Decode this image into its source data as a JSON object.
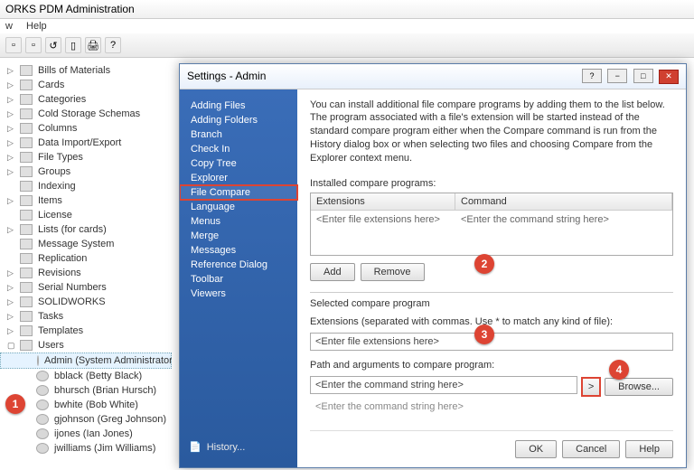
{
  "window": {
    "title": "ORKS PDM Administration"
  },
  "menu": {
    "item0": "w",
    "item1": "Help"
  },
  "tree": {
    "bom": "Bills of Materials",
    "cards": "Cards",
    "categories": "Categories",
    "cold": "Cold Storage Schemas",
    "columns": "Columns",
    "dataie": "Data Import/Export",
    "filetypes": "File Types",
    "groups": "Groups",
    "indexing": "Indexing",
    "items": "Items",
    "license": "License",
    "lists": "Lists (for cards)",
    "msg": "Message System",
    "replication": "Replication",
    "revisions": "Revisions",
    "serials": "Serial Numbers",
    "solidworks": "SOLIDWORKS",
    "tasks": "Tasks",
    "templates": "Templates",
    "users": "Users",
    "user0": "Admin (System Administrator)",
    "user1": "bblack (Betty Black)",
    "user2": "bhursch (Brian Hursch)",
    "user3": "bwhite (Bob White)",
    "user4": "gjohnson (Greg Johnson)",
    "user5": "ijones (Ian Jones)",
    "user6": "jwilliams (Jim Williams)"
  },
  "dlg": {
    "title": "Settings - Admin",
    "nav": {
      "adding_files": "Adding Files",
      "adding_folders": "Adding Folders",
      "branch": "Branch",
      "check_in": "Check In",
      "copy_tree": "Copy Tree",
      "explorer": "Explorer",
      "file_compare": "File Compare",
      "language": "Language",
      "menus": "Menus",
      "merge": "Merge",
      "messages": "Messages",
      "ref_dlg": "Reference Dialog",
      "toolbar": "Toolbar",
      "viewers": "Viewers",
      "history": "History..."
    },
    "content": {
      "intro": "You can install additional file compare programs by adding them to the list below. The program associated with a file's extension will be started instead of the standard compare program either when the Compare command is run from the History dialog box or when selecting two files and choosing Compare from the Explorer context menu.",
      "installed_lbl": "Installed compare programs:",
      "col_ext": "Extensions",
      "col_cmd": "Command",
      "row_ext_ph": "<Enter file extensions here>",
      "row_cmd_ph": "<Enter the command string here>",
      "add": "Add",
      "remove": "Remove",
      "selected_lbl": "Selected compare program",
      "ext_lbl": "Extensions (separated with commas. Use * to match any kind of file):",
      "ext_val": "<Enter file extensions here>",
      "path_lbl": "Path and arguments to compare program:",
      "cmd_val": "<Enter the command string here>",
      "arrow": ">",
      "browse": "Browse...",
      "preview": "<Enter the command string here>",
      "ok": "OK",
      "cancel": "Cancel",
      "help": "Help"
    }
  },
  "callouts": {
    "c1": "1",
    "c2": "2",
    "c3": "3",
    "c4": "4"
  }
}
